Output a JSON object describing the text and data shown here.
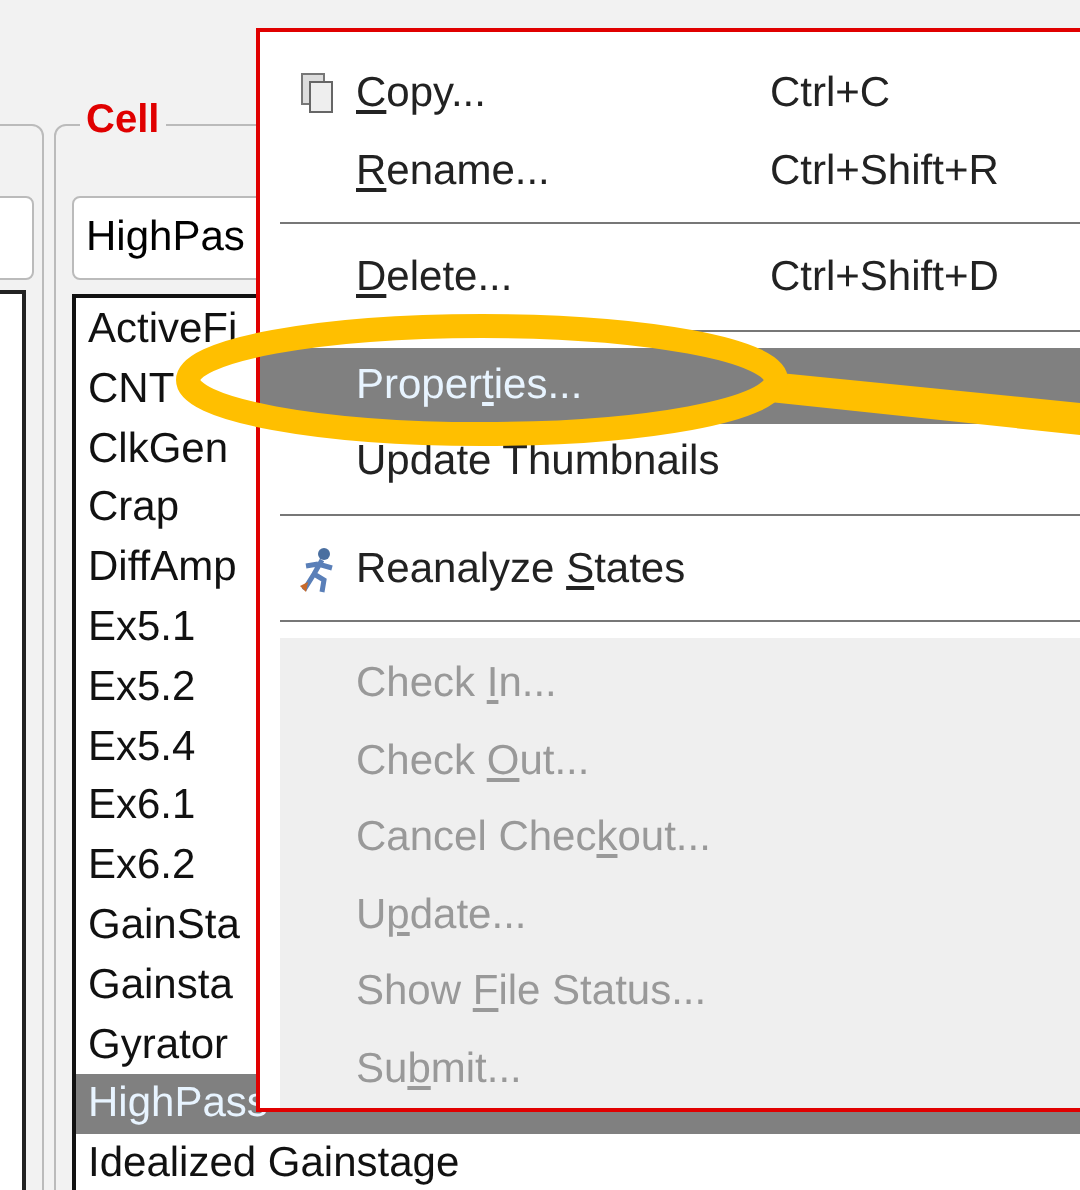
{
  "group": {
    "title": "Cell"
  },
  "combo": {
    "value": "HighPas"
  },
  "list": {
    "items": [
      {
        "label": "ActiveFi",
        "selected": false
      },
      {
        "label": "CNT",
        "selected": false
      },
      {
        "label": "ClkGen",
        "selected": false
      },
      {
        "label": "Crap",
        "selected": false
      },
      {
        "label": "DiffAmp",
        "selected": false
      },
      {
        "label": "Ex5.1",
        "selected": false
      },
      {
        "label": "Ex5.2",
        "selected": false
      },
      {
        "label": "Ex5.4",
        "selected": false
      },
      {
        "label": "Ex6.1",
        "selected": false
      },
      {
        "label": "Ex6.2",
        "selected": false
      },
      {
        "label": "GainSta",
        "selected": false
      },
      {
        "label": "Gainsta",
        "selected": false
      },
      {
        "label": "Gyrator",
        "selected": false
      },
      {
        "label": "HighPass",
        "selected": true
      },
      {
        "label": "Idealized Gainstage",
        "selected": false
      }
    ]
  },
  "menu": {
    "sections": [
      {
        "disabled": false,
        "items": [
          {
            "key": "C",
            "post": "opy...",
            "shortcut": "Ctrl+C",
            "selected": false
          },
          {
            "key": "R",
            "post": "ename...",
            "shortcut": "Ctrl+Shift+R",
            "selected": false
          }
        ]
      },
      {
        "disabled": false,
        "items": [
          {
            "key": "D",
            "post": "elete...",
            "shortcut": "Ctrl+Shift+D",
            "selected": false
          }
        ]
      },
      {
        "disabled": false,
        "items": [
          {
            "pre": "Proper",
            "key": "t",
            "post": "ies...",
            "selected": true
          },
          {
            "pre": "Update Thumbnails",
            "selected": false
          }
        ]
      },
      {
        "disabled": false,
        "items": [
          {
            "pre": "Reanalyze ",
            "key": "S",
            "post": "tates",
            "selected": false
          }
        ]
      },
      {
        "disabled": true,
        "items": [
          {
            "pre": "Check ",
            "key": "I",
            "post": "n...",
            "selected": false
          },
          {
            "pre": "Check ",
            "key": "O",
            "post": "ut...",
            "selected": false
          },
          {
            "pre": "Cancel Chec",
            "key": "k",
            "post": "out...",
            "selected": false
          },
          {
            "pre": "U",
            "key": "p",
            "post": "date...",
            "selected": false
          },
          {
            "pre": "Show ",
            "key": "F",
            "post": "ile Status...",
            "selected": false
          },
          {
            "pre": "Su",
            "key": "b",
            "post": "mit...",
            "selected": false
          }
        ]
      }
    ]
  }
}
